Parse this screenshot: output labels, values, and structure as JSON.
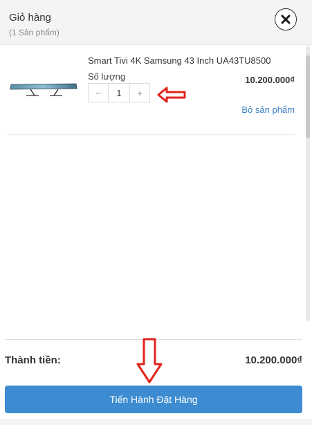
{
  "cart": {
    "title": "Giỏ hàng",
    "subtitle": "(1 Sản phẩm)"
  },
  "icons": {
    "close": "close-icon",
    "annotation_arrow_left": "arrow-left-icon",
    "annotation_arrow_down": "arrow-down-icon"
  },
  "item": {
    "name": "Smart Tivi 4K Samsung 43 Inch UA43TU8500",
    "quantity_label": "Số lượng",
    "quantity": "1",
    "decrement": "−",
    "increment": "+",
    "price": "10.200.000₫",
    "remove_label": "Bỏ sản phẩm"
  },
  "summary": {
    "total_label": "Thành tiền:",
    "total_value": "10.200.000₫"
  },
  "checkout": {
    "label": "Tiến Hành Đặt Hàng"
  },
  "colors": {
    "accent": "#3d8bd0",
    "link": "#3a7fc4",
    "annotation": "#e0231c"
  }
}
